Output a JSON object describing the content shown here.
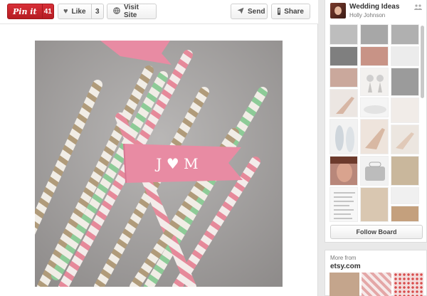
{
  "toolbar": {
    "pin_label": "Pin it",
    "pin_count": "41",
    "like_label": "Like",
    "like_count": "3",
    "visit_label": "Visit Site",
    "send_label": "Send",
    "share_label": "Share",
    "fb_glyph": "f"
  },
  "pin_image": {
    "flag_text": "J ♥ M",
    "accent": "#e77fa0"
  },
  "board": {
    "title": "Wedding Ideas",
    "owner": "Holly Johnson",
    "follow_label": "Follow Board"
  },
  "more_from": {
    "label": "More from",
    "source": "etsy.com"
  }
}
